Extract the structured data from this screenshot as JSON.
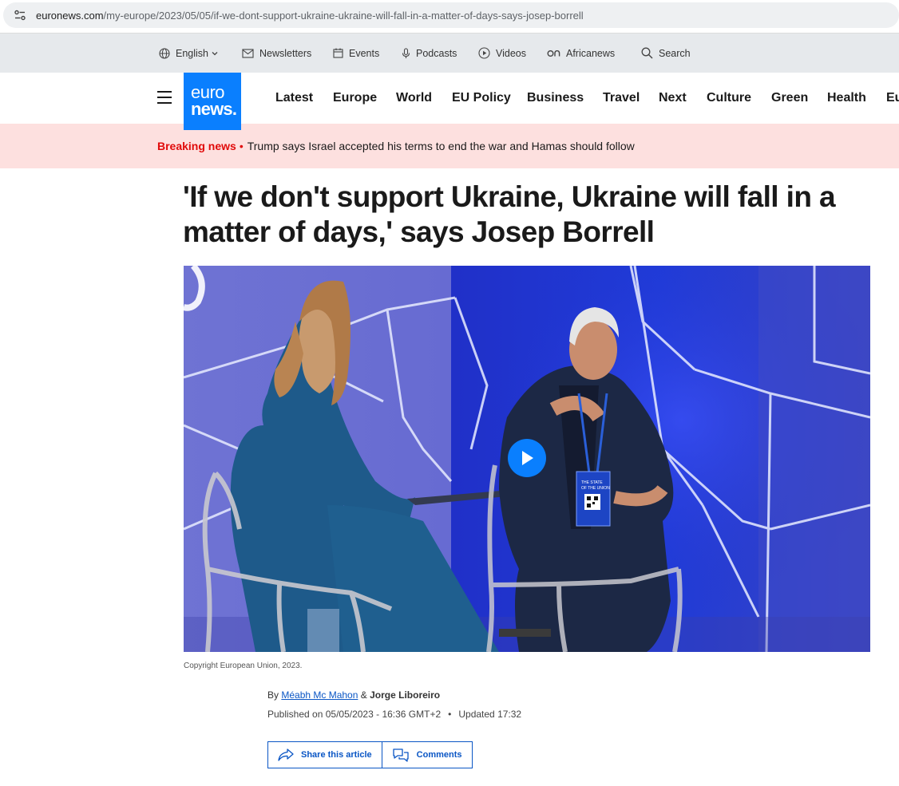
{
  "browser": {
    "url_host": "euronews.com",
    "url_path": "/my-europe/2023/05/05/if-we-dont-support-ukraine-ukraine-will-fall-in-a-matter-of-days-says-josep-borrell"
  },
  "utility_bar": {
    "language": "English",
    "newsletters": "Newsletters",
    "events": "Events",
    "podcasts": "Podcasts",
    "videos": "Videos",
    "africanews": "Africanews",
    "search": "Search"
  },
  "logo": {
    "line1": "euro",
    "line2": "news."
  },
  "nav": {
    "items": [
      "Latest",
      "Europe",
      "World",
      "EU Policy",
      "Business",
      "Travel",
      "Next",
      "Culture",
      "Green",
      "Health",
      "Eu"
    ]
  },
  "breaking": {
    "label": "Breaking news",
    "dot": "•",
    "text": "Trump says Israel accepted his terms to end the war and Hamas should follow"
  },
  "article": {
    "headline": "'If we don't support Ukraine, Ukraine will fall in a matter of days,' says Josep Borrell",
    "caption": "Copyright European Union, 2023.",
    "byline_prefix": "By",
    "author1": "Méabh Mc Mahon",
    "byline_amp": "&",
    "author2": "Jorge Liboreiro",
    "published": "Published on 05/05/2023 - 16:36 GMT+2",
    "updated_sep": "•",
    "updated": "Updated 17:32"
  },
  "actions": {
    "share": "Share this article",
    "comments": "Comments"
  },
  "badge": {
    "title_line1": "THE STATE",
    "title_line2": "OF THE UNION"
  },
  "colors": {
    "brand_blue": "#0a7ffe",
    "link_blue": "#0a56c5",
    "breaking_red": "#e10b0b",
    "breaking_bg": "#fde0df"
  }
}
